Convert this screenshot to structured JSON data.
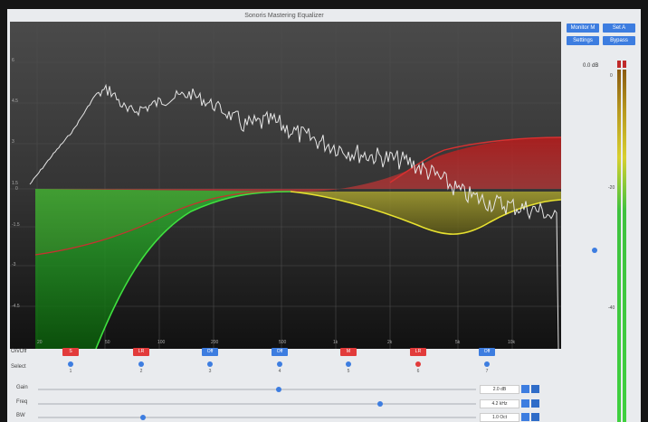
{
  "window_title": "Sonoris Mastering Equalizer",
  "top_buttons": {
    "monitor": "Monitor M",
    "set": "Set A",
    "settings": "Settings",
    "bypass": "Bypass"
  },
  "plot": {
    "y_labels": [
      "6",
      "4.5",
      "3",
      "1.5",
      "0",
      "-1.5",
      "-3",
      "-4.5"
    ],
    "x_labels": [
      "20",
      "50",
      "100",
      "200",
      "500",
      "1k",
      "2k",
      "5k",
      "10k"
    ]
  },
  "bands": {
    "onoff_label": "On/Off",
    "select_label": "Select",
    "items": [
      {
        "state": "S",
        "color": "red",
        "num": "1",
        "selected": false
      },
      {
        "state": "LR",
        "color": "red",
        "num": "2",
        "selected": false
      },
      {
        "state": "Off",
        "color": "blue",
        "num": "3",
        "selected": false
      },
      {
        "state": "Off",
        "color": "blue",
        "num": "4",
        "selected": false
      },
      {
        "state": "M",
        "color": "red",
        "num": "5",
        "selected": false
      },
      {
        "state": "LR",
        "color": "red",
        "num": "6",
        "selected": true
      },
      {
        "state": "Off",
        "color": "blue",
        "num": "7",
        "selected": false
      }
    ]
  },
  "params": [
    {
      "label": "Gain",
      "value": "2.0 dB",
      "pos": 0.55
    },
    {
      "label": "Freq",
      "value": "4.2 kHz",
      "pos": 0.78
    },
    {
      "label": "BW",
      "value": "1.0 Oct",
      "pos": 0.24
    }
  ],
  "meter": {
    "readout": "0.0 dB",
    "ticks": [
      "0",
      "-20",
      "-40"
    ]
  },
  "colors": {
    "accent": "#3d7de0",
    "band_red": "#e23b3b",
    "curve_green": "#3fe23f",
    "curve_yellow": "#e8e230"
  }
}
